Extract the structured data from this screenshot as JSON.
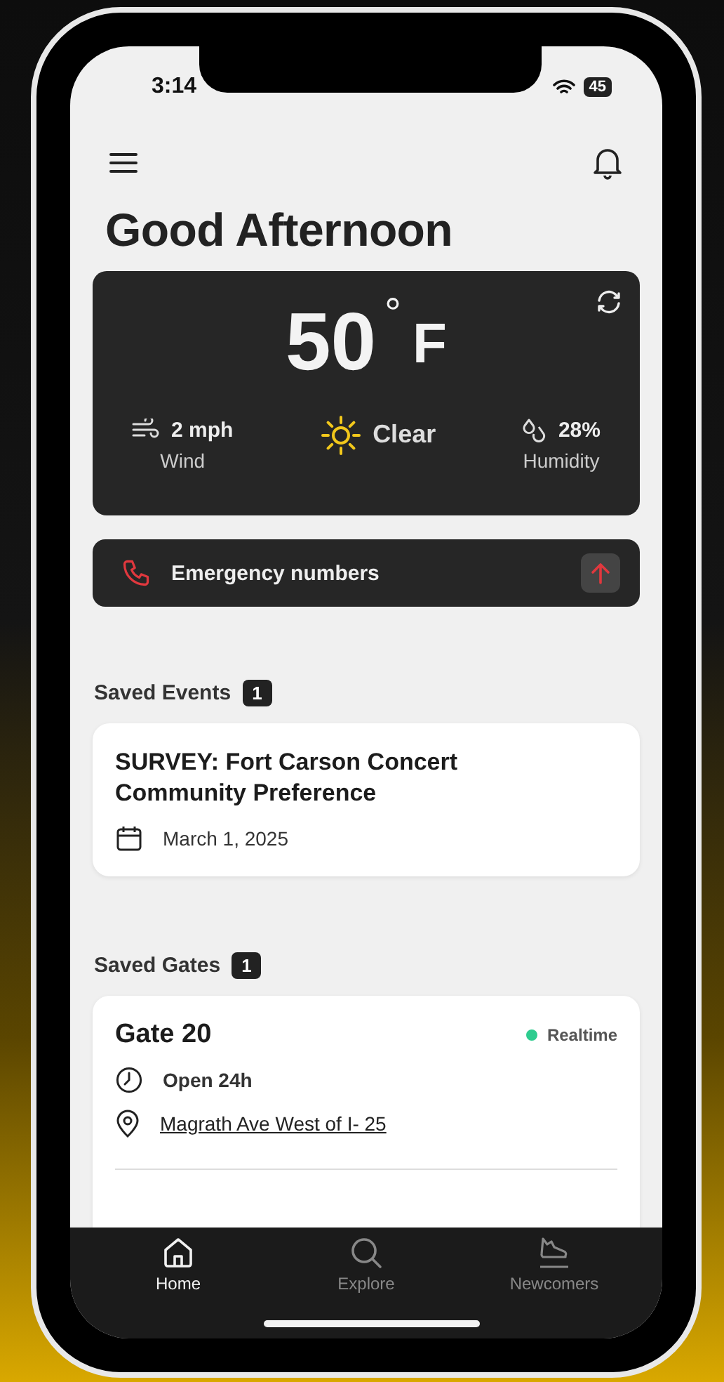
{
  "status_bar": {
    "time": "3:14",
    "battery": "45"
  },
  "greeting": "Good Afternoon",
  "weather": {
    "temperature": "50",
    "degree": "°",
    "unit": "F",
    "wind": {
      "value": "2 mph",
      "label": "Wind"
    },
    "condition": "Clear",
    "humidity": {
      "value": "28%",
      "label": "Humidity"
    }
  },
  "emergency": {
    "label": "Emergency numbers"
  },
  "saved_events": {
    "title": "Saved Events",
    "count": "1",
    "items": [
      {
        "title": "SURVEY: Fort Carson Concert Community Preference",
        "date": "March 1, 2025"
      }
    ]
  },
  "saved_gates": {
    "title": "Saved Gates",
    "count": "1",
    "items": [
      {
        "name": "Gate 20",
        "status": "Realtime",
        "color": "#2ecc8f",
        "hours": "Open 24h",
        "location": "Magrath Ave West of I- 25"
      }
    ]
  },
  "tab_bar": [
    {
      "kind": "home",
      "label": "Home",
      "selected": true
    },
    {
      "kind": "search",
      "label": "Explore",
      "selected": false
    },
    {
      "kind": "shoe",
      "label": "Newcomers",
      "selected": false
    }
  ]
}
